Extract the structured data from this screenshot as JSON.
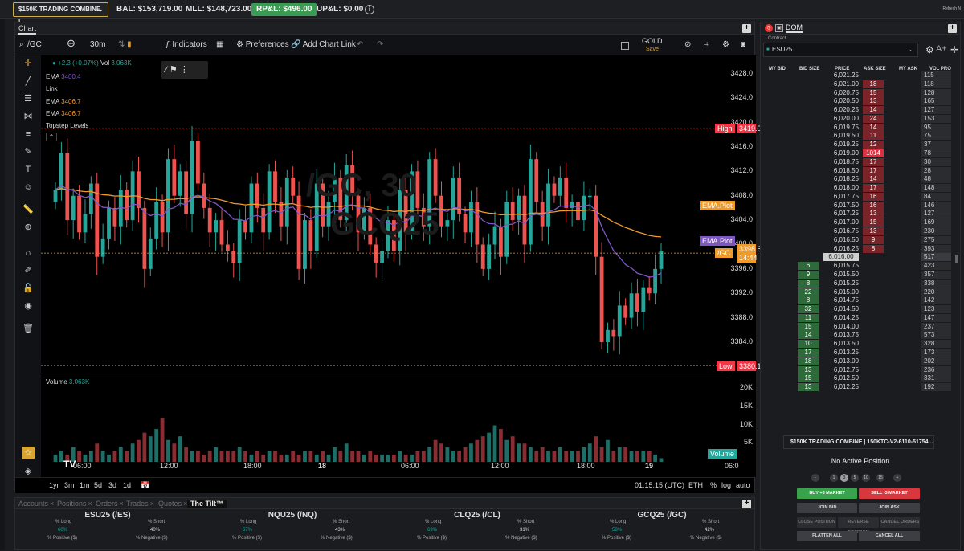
{
  "topbar": {
    "account": "$150K TRADING COMBINE |...",
    "bal": "BAL: $153,719.00",
    "mll": "MLL: $148,723.00",
    "rpl": "RP&L: $496.00",
    "upl": "UP&L: $0.00",
    "refresh": "Refresh N"
  },
  "chart": {
    "panel_title": "Chart",
    "symbol": "/GC",
    "interval": "30m",
    "indicators": "Indicators",
    "preferences": "Preferences",
    "add_link": "Add Chart Link",
    "gold": "GOLD",
    "save": "Save",
    "legend": {
      "change": "+2.3 (+0.07%)",
      "vol_label": "Vol",
      "vol_value": "3.063K",
      "ema1_label": "EMA",
      "ema1_value": "3400.4",
      "link": "Link",
      "ema2_label": "EMA",
      "ema2_value": "3406.7",
      "ema3_label": "EMA",
      "ema3_value": "3406.7",
      "topstep": "Topstep Levels"
    },
    "watermark_1": "/GC, 30",
    "watermark_2": "GCQ25",
    "price_ticks": [
      "3428.0",
      "3424.0",
      "3420.0",
      "3416.0",
      "3412.0",
      "3408.0",
      "3404.0",
      "3400.0",
      "3396.0",
      "3392.0",
      "3388.0",
      "3384.0"
    ],
    "price_min": 3379,
    "price_max": 3431,
    "high_label": "High",
    "high_value": "3419.0",
    "high": 3419.0,
    "low_label": "Low",
    "low_value": "3380.1",
    "low": 3380.1,
    "ema_plot_label": "EMA.Plot",
    "ema_plot2_label": "EMA.Plot",
    "current_symbol": "/GC",
    "current_price": "3398.6",
    "current_countdown": "14:44",
    "current": 3398.6,
    "volume_label": "Volume",
    "volume_value": "3.063K",
    "vol_ticks": [
      "20K",
      "15K",
      "10K",
      "5K"
    ],
    "volume_tag": "Volume",
    "time_ticks": [
      "06:00",
      "12:00",
      "18:00",
      "18",
      "06:00",
      "12:00",
      "18:00",
      "19",
      "06:0"
    ],
    "ranges": [
      "1yr",
      "3m",
      "1m",
      "5d",
      "3d",
      "1d"
    ],
    "clock": "01:15:15 (UTC)",
    "eth": "ETH",
    "pct": "%",
    "log": "log",
    "auto": "auto",
    "colors": {
      "up": "#26a69a",
      "down": "#ef5350",
      "ema_orange": "#f09a2a",
      "ema_purple": "#7e57c2",
      "level": "#f23645"
    }
  },
  "chart_data": {
    "type": "candlestick",
    "title": "",
    "ylim": [
      3379,
      3431
    ],
    "closes": [
      3409,
      3415,
      3404,
      3408,
      3402,
      3405,
      3410,
      3398,
      3401,
      3406,
      3403,
      3409,
      3404,
      3412,
      3406,
      3396,
      3401,
      3407,
      3402,
      3414,
      3408,
      3412,
      3405,
      3417,
      3410,
      3406,
      3402,
      3404,
      3400,
      3399,
      3397,
      3404,
      3402,
      3410,
      3406,
      3402,
      3412,
      3407,
      3403,
      3411,
      3408,
      3396,
      3404,
      3399,
      3410,
      3403,
      3407,
      3411,
      3404,
      3413,
      3408,
      3402,
      3406,
      3400,
      3397,
      3399,
      3404,
      3399,
      3409,
      3402,
      3412,
      3406,
      3403,
      3414,
      3408,
      3403,
      3404,
      3411,
      3405,
      3402,
      3407,
      3400,
      3396,
      3400,
      3403,
      3398,
      3407,
      3404,
      3408,
      3400,
      3414,
      3407,
      3403,
      3410,
      3408,
      3411,
      3406,
      3407,
      3404,
      3408,
      3408,
      3398,
      3384,
      3386,
      3385,
      3390,
      3388,
      3392,
      3389,
      3393,
      3392,
      3396,
      3399
    ],
    "volumes": [
      2,
      3,
      2,
      4,
      3,
      2,
      3,
      5,
      3,
      2,
      3,
      4,
      3,
      5,
      6,
      8,
      7,
      9,
      12,
      6,
      5,
      7,
      4,
      3,
      3,
      2,
      3,
      4,
      3,
      3,
      3,
      4,
      3,
      2,
      3,
      2,
      3,
      3,
      2,
      2,
      3,
      2,
      3,
      3,
      2,
      3,
      2,
      4,
      3,
      5,
      3,
      3,
      2,
      3,
      2,
      2,
      2,
      2,
      3,
      2,
      2,
      3,
      3,
      4,
      6,
      5,
      4,
      3,
      3,
      4,
      5,
      6,
      7,
      8,
      10,
      9,
      6,
      7,
      5,
      5,
      4,
      3,
      4,
      3,
      3,
      4,
      3,
      3,
      3,
      4,
      5,
      7,
      4,
      6,
      3,
      4,
      4,
      3,
      3,
      3,
      3,
      2,
      1
    ]
  },
  "bottom": {
    "tabs": [
      "Accounts",
      "Positions",
      "Orders",
      "Trades",
      "Quotes",
      "The Tilt™"
    ],
    "markets": [
      {
        "name": "ESU25 (/ES)",
        "long_label": "% Long",
        "short_label": "% Short",
        "long": "60%",
        "short": "40%",
        "pos": "% Positive ($)",
        "neg": "% Negative ($)"
      },
      {
        "name": "NQU25 (/NQ)",
        "long_label": "% Long",
        "short_label": "% Short",
        "long": "57%",
        "short": "43%",
        "pos": "% Positive ($)",
        "neg": "% Negative ($)"
      },
      {
        "name": "CLQ25 (/CL)",
        "long_label": "% Long",
        "short_label": "% Short",
        "long": "69%",
        "short": "31%",
        "pos": "% Positive ($)",
        "neg": "% Negative ($)"
      },
      {
        "name": "GCQ25 (/GC)",
        "long_label": "% Long",
        "short_label": "% Short",
        "long": "58%",
        "short": "42%",
        "pos": "% Positive ($)",
        "neg": "% Negative ($)"
      }
    ]
  },
  "dom": {
    "title": "DOM",
    "contract_label": "Contract",
    "contract": "ESU25",
    "headers": [
      "MY BID",
      "BID SIZE",
      "PRICE",
      "ASK SIZE",
      "MY ASK",
      "VOL PRO"
    ],
    "asks": [
      [
        "6,021.25",
        "",
        "115"
      ],
      [
        "6,021.00",
        "18",
        "118"
      ],
      [
        "6,020.75",
        "15",
        "128"
      ],
      [
        "6,020.50",
        "13",
        "165"
      ],
      [
        "6,020.25",
        "14",
        "127"
      ],
      [
        "6,020.00",
        "24",
        "153"
      ],
      [
        "6,019.75",
        "14",
        "95"
      ],
      [
        "6,019.50",
        "11",
        "75"
      ],
      [
        "6,019.25",
        "12",
        "37"
      ],
      [
        "6,019.00",
        "1014",
        "78"
      ],
      [
        "6,018.75",
        "17",
        "30"
      ],
      [
        "6,018.50",
        "17",
        "28"
      ],
      [
        "6,018.25",
        "14",
        "48"
      ],
      [
        "6,018.00",
        "17",
        "148"
      ],
      [
        "6,017.75",
        "16",
        "84"
      ],
      [
        "6,017.50",
        "16",
        "146"
      ],
      [
        "6,017.25",
        "13",
        "127"
      ],
      [
        "6,017.00",
        "15",
        "169"
      ],
      [
        "6,016.75",
        "13",
        "230"
      ],
      [
        "6,016.50",
        "9",
        "275"
      ],
      [
        "6,016.25",
        "8",
        "393"
      ]
    ],
    "last": [
      "6,016.00",
      "517"
    ],
    "bids": [
      [
        "6",
        "6,015.75",
        "423"
      ],
      [
        "9",
        "6,015.50",
        "357"
      ],
      [
        "8",
        "6,015.25",
        "338"
      ],
      [
        "22",
        "6,015.00",
        "220"
      ],
      [
        "8",
        "6,014.75",
        "142"
      ],
      [
        "32",
        "6,014.50",
        "123"
      ],
      [
        "11",
        "6,014.25",
        "147"
      ],
      [
        "15",
        "6,014.00",
        "237"
      ],
      [
        "14",
        "6,013.75",
        "573"
      ],
      [
        "10",
        "6,013.50",
        "328"
      ],
      [
        "17",
        "6,013.25",
        "173"
      ],
      [
        "18",
        "6,013.00",
        "202"
      ],
      [
        "13",
        "6,012.75",
        "236"
      ],
      [
        "15",
        "6,012.50",
        "331"
      ],
      [
        "13",
        "6,012.25",
        "192"
      ]
    ],
    "account": "$150K TRADING COMBINE | 150KTC-V2-6110-51754...",
    "no_position": "No Active Position",
    "quantities": [
      "-",
      "1",
      "3",
      "5",
      "10",
      "15",
      "+"
    ],
    "buy": "BUY +3 MARKET",
    "sell": "SELL -3 MARKET",
    "join_bid": "JOIN BID",
    "join_ask": "JOIN ASK",
    "close_pos": "CLOSE POSITION",
    "reverse_pos": "REVERSE POSITION",
    "cancel_orders": "CANCEL ORDERS",
    "flatten": "FLATTEN ALL",
    "cancel_all": "CANCEL ALL"
  }
}
